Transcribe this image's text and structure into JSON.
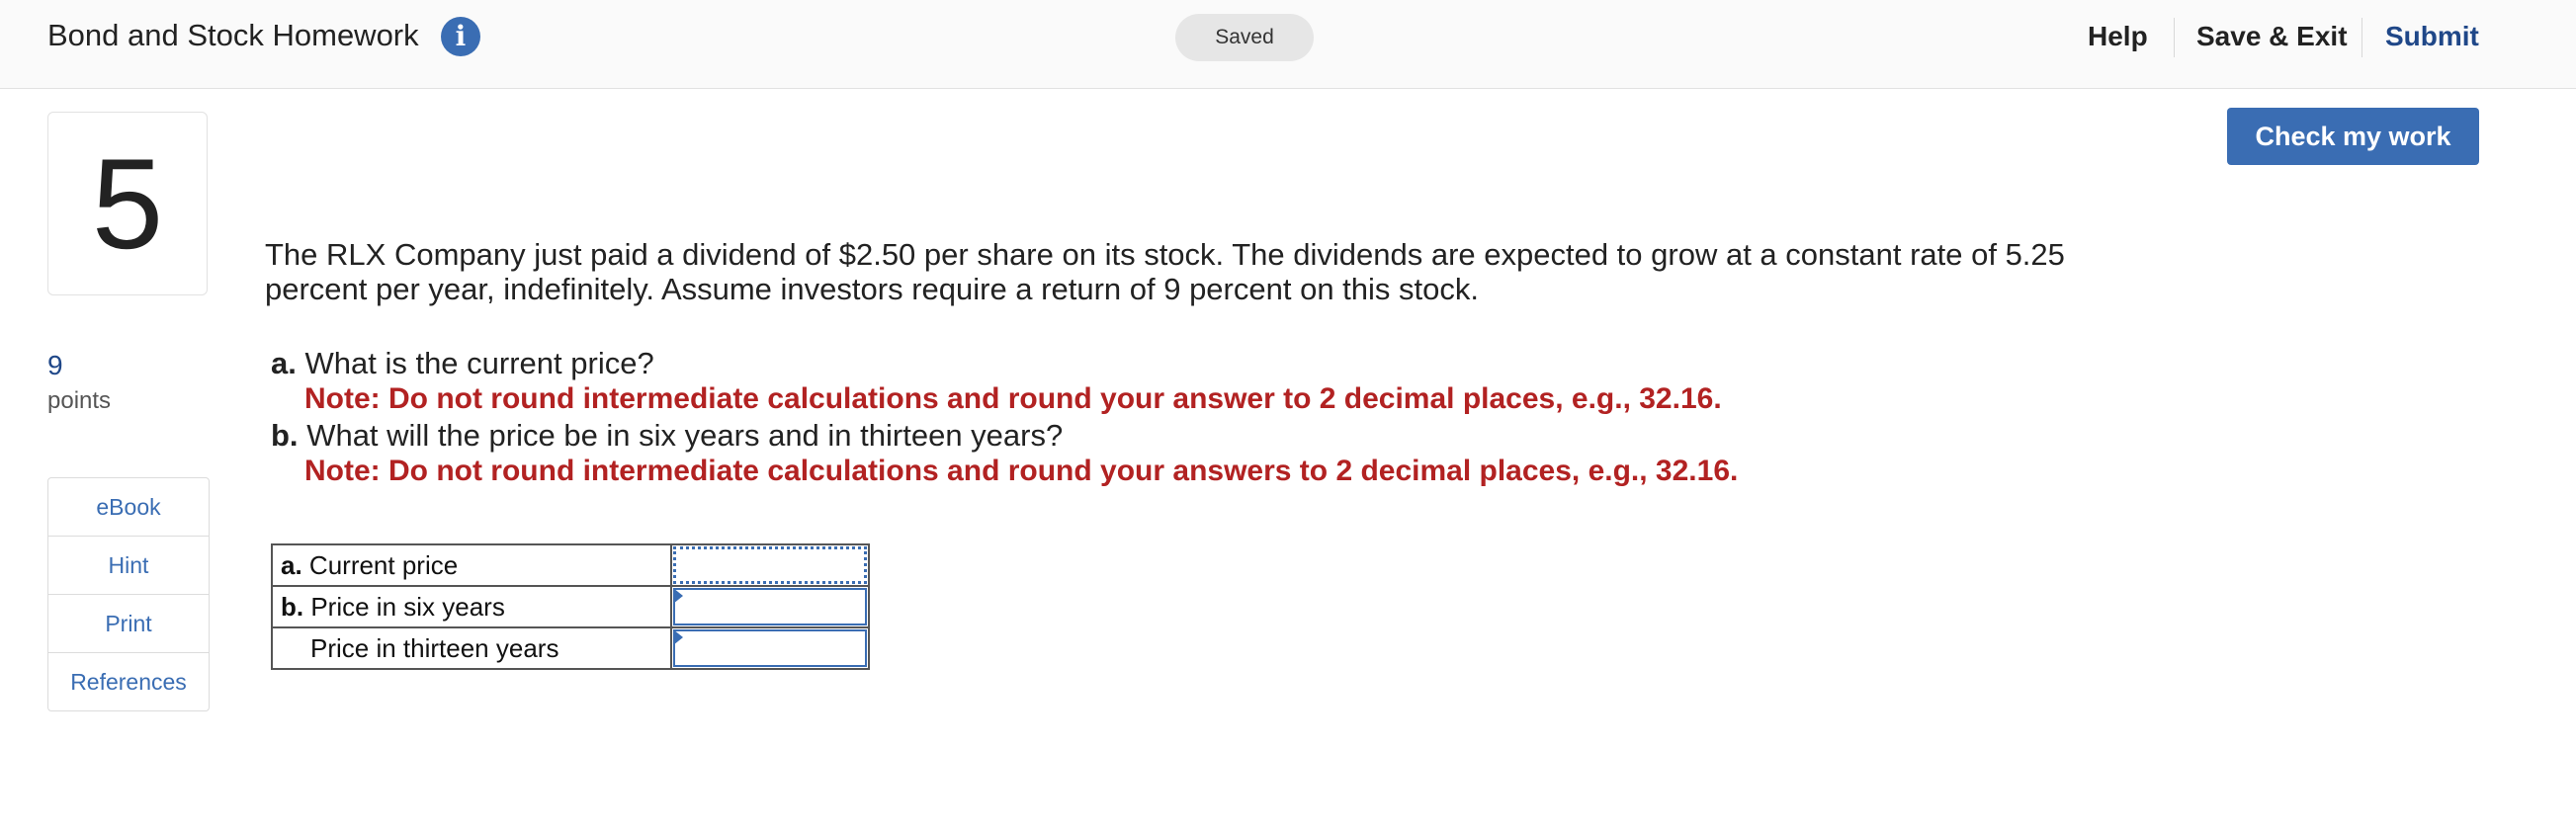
{
  "header": {
    "title": "Bond and Stock Homework",
    "info_icon": "i",
    "status": "Saved",
    "help": "Help",
    "save_exit": "Save & Exit",
    "submit": "Submit"
  },
  "question": {
    "number": "5",
    "points_value": "9",
    "points_label": "points",
    "check_button": "Check my work",
    "resources": [
      "eBook",
      "Hint",
      "Print",
      "References"
    ],
    "prompt": "The RLX Company just paid a dividend of $2.50 per share on its stock. The dividends are expected to grow at a constant rate of 5.25 percent per year, indefinitely. Assume investors require a return of 9 percent on this stock.",
    "part_a_label": "a.",
    "part_a_text": "What is the current price?",
    "part_a_note": "Note: Do not round intermediate calculations and round your answer to 2 decimal places, e.g., 32.16.",
    "part_b_label": "b.",
    "part_b_text": "What will the price be in six years and in thirteen years?",
    "part_b_note": "Note: Do not round intermediate calculations and round your answers to 2 decimal places, e.g., 32.16."
  },
  "answer_table": {
    "rows": [
      {
        "prefix": "a.",
        "label": "Current price",
        "value": ""
      },
      {
        "prefix": "b.",
        "label": "Price in six years",
        "value": ""
      },
      {
        "prefix": "",
        "label": "Price in thirteen years",
        "value": ""
      }
    ]
  },
  "colors": {
    "accent": "#3a6db3",
    "note_red": "#b22222",
    "submit_blue": "#1f4788"
  }
}
